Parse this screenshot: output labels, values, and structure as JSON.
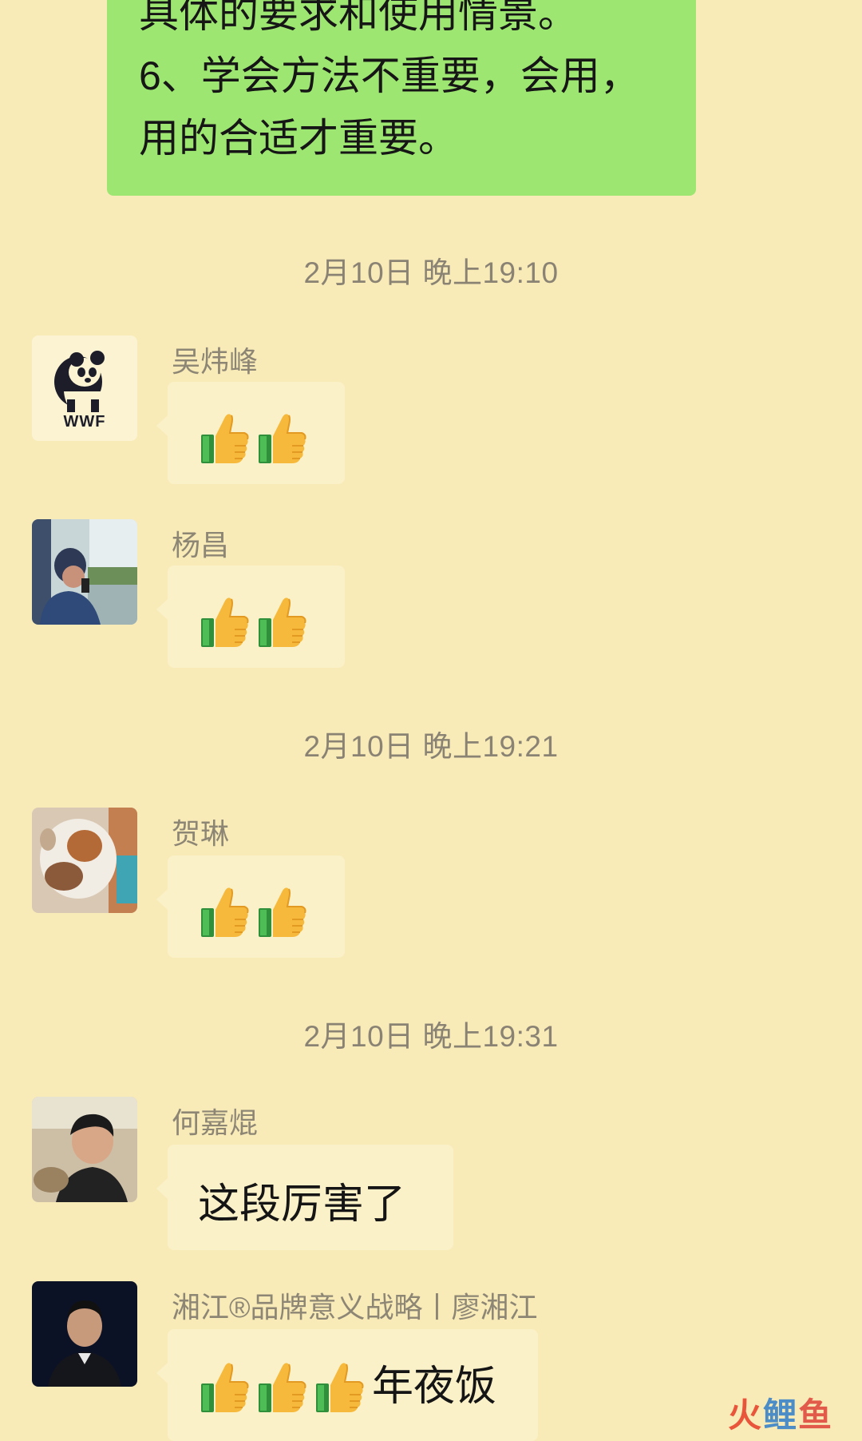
{
  "own_message": {
    "lines": [
      "具体的要求和使用情景。",
      "6、学会方法不重要，会用，",
      "用的合适才重要。"
    ]
  },
  "timestamps": [
    "2月10日 晚上19:10",
    "2月10日 晚上19:21",
    "2月10日 晚上19:31"
  ],
  "messages": [
    {
      "sender": "吴炜峰",
      "avatar": "wwf-panda-logo",
      "content": "thumbs-up-emoji x2"
    },
    {
      "sender": "杨昌",
      "avatar": "photo-man-on-phone",
      "content": "thumbs-up-emoji x2"
    },
    {
      "sender": "贺琳",
      "avatar": "photo-cat",
      "content": "thumbs-up-emoji x2"
    },
    {
      "sender": "何嘉焜",
      "avatar": "photo-young-man",
      "text": "这段厉害了"
    },
    {
      "sender": "湘江®品牌意义战略丨廖湘江",
      "avatar": "photo-man-dark",
      "text": "年夜饭",
      "content": "thumbs-up-emoji x3"
    }
  ],
  "avatar_logo_text": "WWF",
  "watermark": {
    "part1": "火",
    "part2": "鲤",
    "part3": "鱼"
  },
  "colors": {
    "background": "#f8ebb8",
    "own_bubble": "#9ee672",
    "other_bubble": "#fbf1c8",
    "timestamp_text": "#8a8374"
  }
}
